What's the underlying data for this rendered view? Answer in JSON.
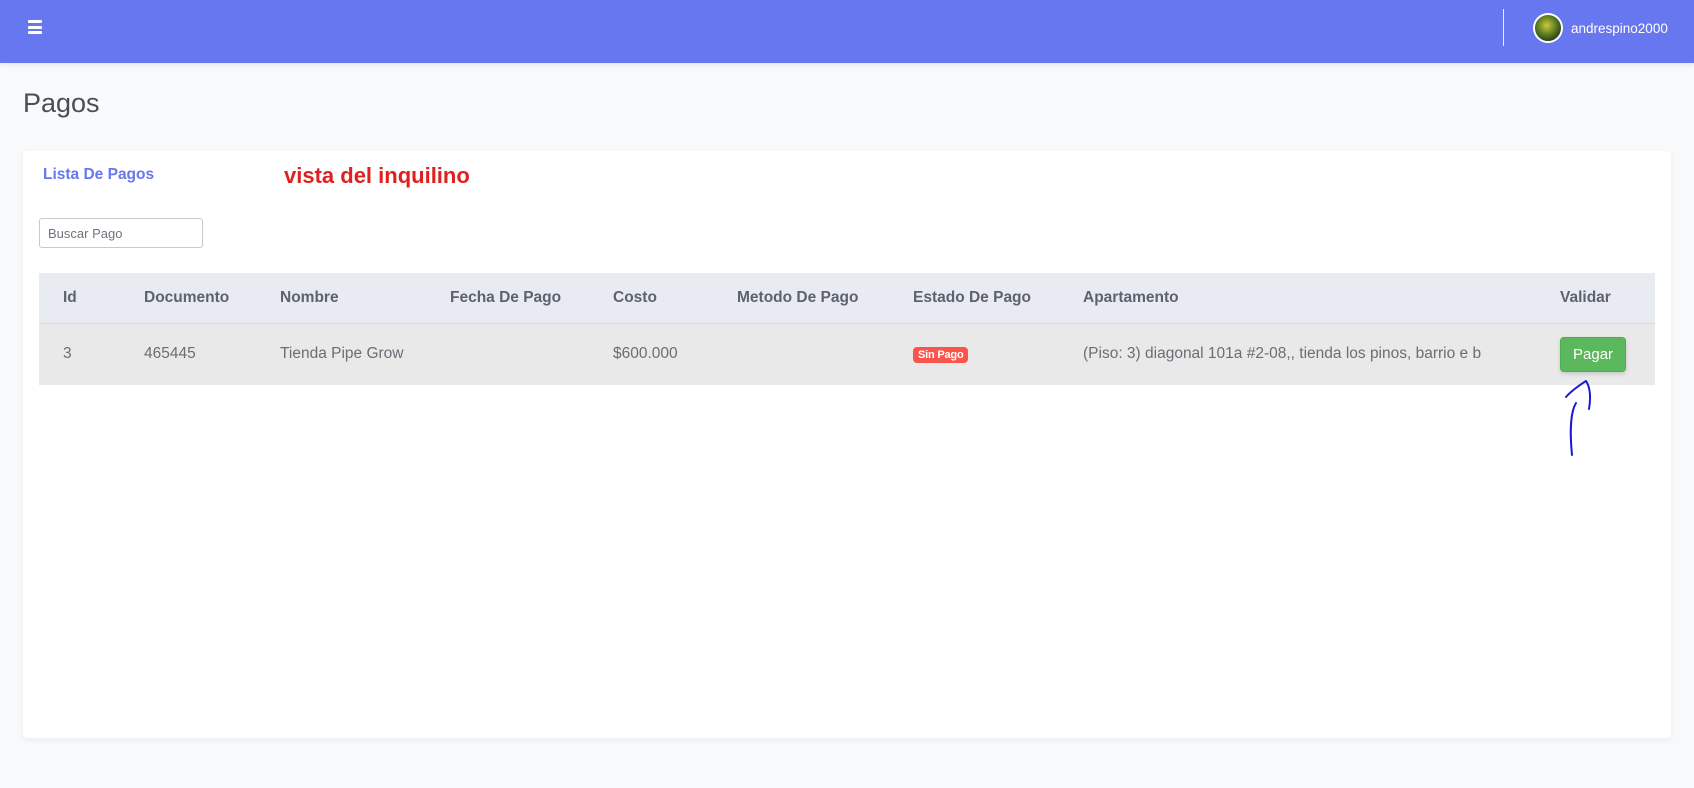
{
  "topbar": {
    "username": "andrespino2000",
    "menu_icon": "hamburger-menu-icon",
    "colors": {
      "bar": "#6777ef"
    }
  },
  "page": {
    "title": "Pagos"
  },
  "card": {
    "header_title": "Lista De Pagos",
    "annotation": "vista del inquilino",
    "search": {
      "placeholder": "Buscar Pago",
      "value": ""
    }
  },
  "table": {
    "columns": [
      "Id",
      "Documento",
      "Nombre",
      "Fecha De Pago",
      "Costo",
      "Metodo De Pago",
      "Estado De Pago",
      "Apartamento",
      "Validar"
    ],
    "rows": [
      {
        "id": "3",
        "documento": "465445",
        "nombre": "Tienda Pipe Grow",
        "fecha": "",
        "costo": "$600.000",
        "metodo": "",
        "estado": "Sin Pago",
        "apartamento": "(Piso: 3) diagonal 101a #2-08,, tienda los pinos, barrio e b",
        "accion": "Pagar"
      }
    ]
  },
  "colors": {
    "accent": "#6777ef",
    "badge_danger": "#fc544b",
    "button_success": "#5cb85c",
    "annotation": "#e0201f",
    "hand_arrow": "#1a1ad6"
  }
}
